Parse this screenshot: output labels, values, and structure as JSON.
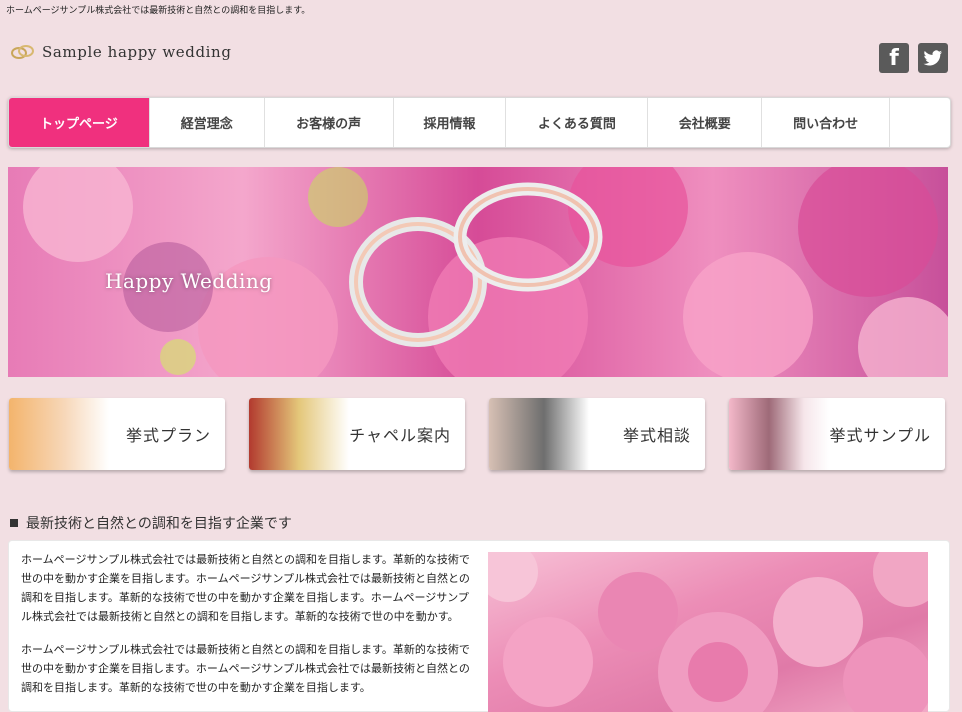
{
  "header": {
    "tagline": "ホームページサンプル株式会社では最新技術と自然との調和を目指します。",
    "logo_text": "Sample happy wedding",
    "social": {
      "facebook_glyph": "f"
    }
  },
  "nav": {
    "items": [
      {
        "label": "トップページ"
      },
      {
        "label": "経営理念"
      },
      {
        "label": "お客様の声"
      },
      {
        "label": "採用情報"
      },
      {
        "label": "よくある質問"
      },
      {
        "label": "会社概要"
      },
      {
        "label": "問い合わせ"
      },
      {
        "label": ""
      }
    ]
  },
  "hero": {
    "caption": "Happy Wedding"
  },
  "cards": [
    {
      "label": "挙式プラン"
    },
    {
      "label": "チャペル案内"
    },
    {
      "label": "挙式相談"
    },
    {
      "label": "挙式サンプル"
    }
  ],
  "section": {
    "title": "最新技術と自然との調和を目指す企業です",
    "paragraphs": [
      "ホームページサンプル株式会社では最新技術と自然との調和を目指します。革新的な技術で世の中を動かす企業を目指します。ホームページサンプル株式会社では最新技術と自然との調和を目指します。革新的な技術で世の中を動かす企業を目指します。ホームページサンプル株式会社では最新技術と自然との調和を目指します。革新的な技術で世の中を動かす。",
      "ホームページサンプル株式会社では最新技術と自然との調和を目指します。革新的な技術で世の中を動かす企業を目指します。ホームページサンプル株式会社では最新技術と自然との調和を目指します。革新的な技術で世の中を動かす企業を目指します。"
    ]
  },
  "colors": {
    "background": "#f2dfe3",
    "accent": "#f0307e",
    "social": "#5a5a5a"
  },
  "icons": [
    "rings-logo-icon",
    "facebook-icon",
    "twitter-icon"
  ]
}
